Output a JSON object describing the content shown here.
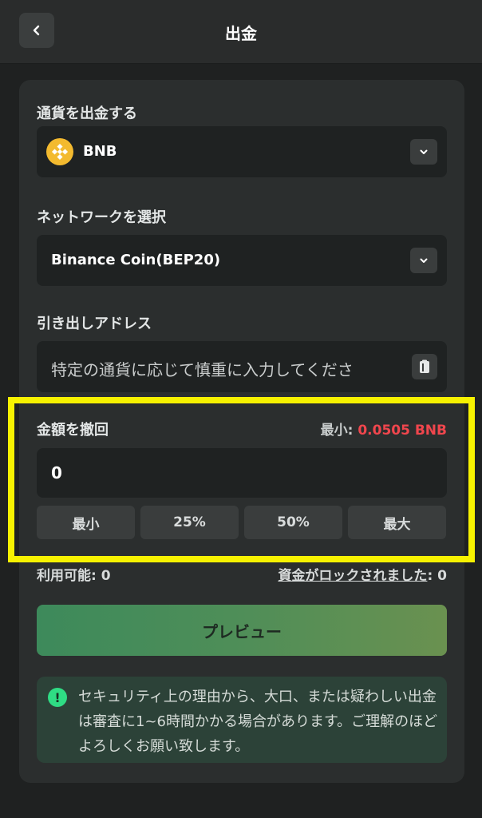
{
  "header": {
    "title": "出金"
  },
  "currency": {
    "label": "通貨を出金する",
    "selected": "BNB"
  },
  "network": {
    "label": "ネットワークを選択",
    "selected": "Binance Coin(BEP20)"
  },
  "address": {
    "label": "引き出しアドレス",
    "placeholder": "特定の通貨に応じて慎重に入力してくださ"
  },
  "amount": {
    "label": "金額を撤回",
    "min_prefix": "最小: ",
    "min_value": "0.0505 BNB",
    "value": "0",
    "quick_buttons": [
      "最小",
      "25%",
      "50%",
      "最大"
    ]
  },
  "balance": {
    "available_label": "利用可能: ",
    "available_value": "0",
    "locked_label": "資金がロックされました",
    "locked_sep": ": ",
    "locked_value": "0"
  },
  "preview_button": "プレビュー",
  "notice": {
    "icon": "!",
    "text": "セキュリティ上の理由から、大口、または疑わしい出金は審査に1~6時間かかる場合があります。ご理解のほどよろしくお願い致します。"
  },
  "colors": {
    "background": "#1f2121",
    "card": "#2b2e2e",
    "accent_green": "#2fdc84",
    "min_red": "#f0464d",
    "highlight_yellow": "#f7f200",
    "bnb_yellow": "#f3ba2f"
  }
}
